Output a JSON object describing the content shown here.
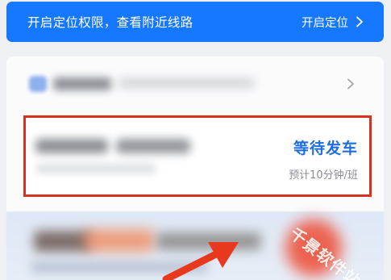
{
  "location_banner": {
    "text": "开启定位权限，查看附近线路",
    "action_label": "开启定位",
    "bg_color": "#1677ff"
  },
  "bus_row": {
    "status": "等待发车",
    "eta": "预计10分钟/班",
    "status_color": "#1f6ddf",
    "highlight_color": "#d9301f"
  },
  "icons": {
    "banner_chevron": "chevron-right-icon",
    "line_chevron": "chevron-right-icon",
    "line_icon": "bus-line-icon",
    "arrow": "red-arrow-annotation"
  },
  "watermark": {
    "text": "千景软件站"
  }
}
